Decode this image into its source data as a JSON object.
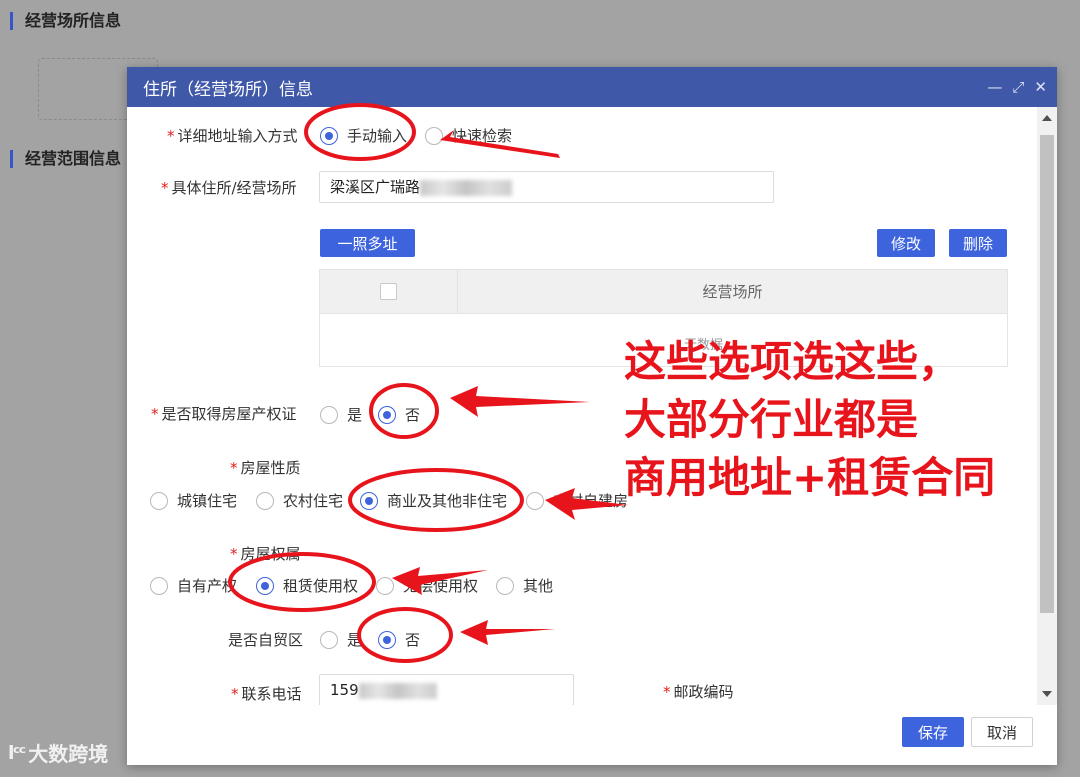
{
  "background": {
    "section1_title": "经营场所信息",
    "section2_title": "经营范围信息"
  },
  "watermark": {
    "logo": "lᶜᶜ",
    "text": "大数跨境"
  },
  "dialog": {
    "title": "住所（经营场所）信息",
    "controls": {
      "minimize": "—",
      "maximize": "⤢",
      "close": "✕"
    },
    "address_mode": {
      "label": "详细地址输入方式",
      "options": [
        "手动输入",
        "快速检索"
      ],
      "selected": "手动输入"
    },
    "address": {
      "label": "具体住所/经营场所",
      "value": "梁溪区广瑞路"
    },
    "buttons": {
      "multi_address": "一照多址",
      "edit": "修改",
      "delete": "删除"
    },
    "table": {
      "column": "经营场所",
      "empty_text": "无数据"
    },
    "property_cert": {
      "label": "是否取得房屋产权证",
      "options": [
        "是",
        "否"
      ],
      "selected": "否"
    },
    "house_nature": {
      "label": "房屋性质",
      "options": [
        "城镇住宅",
        "农村住宅",
        "商业及其他非住宅",
        "农村自建房"
      ],
      "selected": "商业及其他非住宅"
    },
    "house_ownership": {
      "label": "房屋权属",
      "options": [
        "自有产权",
        "租赁使用权",
        "无偿使用权",
        "其他"
      ],
      "selected": "租赁使用权"
    },
    "free_trade": {
      "label": "是否自贸区",
      "options": [
        "是",
        "否"
      ],
      "selected": "否"
    },
    "phone": {
      "label": "联系电话",
      "value": "159"
    },
    "postcode": {
      "label": "邮政编码"
    },
    "footer": {
      "save": "保存",
      "cancel": "取消"
    }
  },
  "annotation": {
    "lines": [
      "这些选项选这些，",
      "大部分行业都是",
      "商用地址+租赁合同"
    ],
    "color": "#e8141c"
  }
}
